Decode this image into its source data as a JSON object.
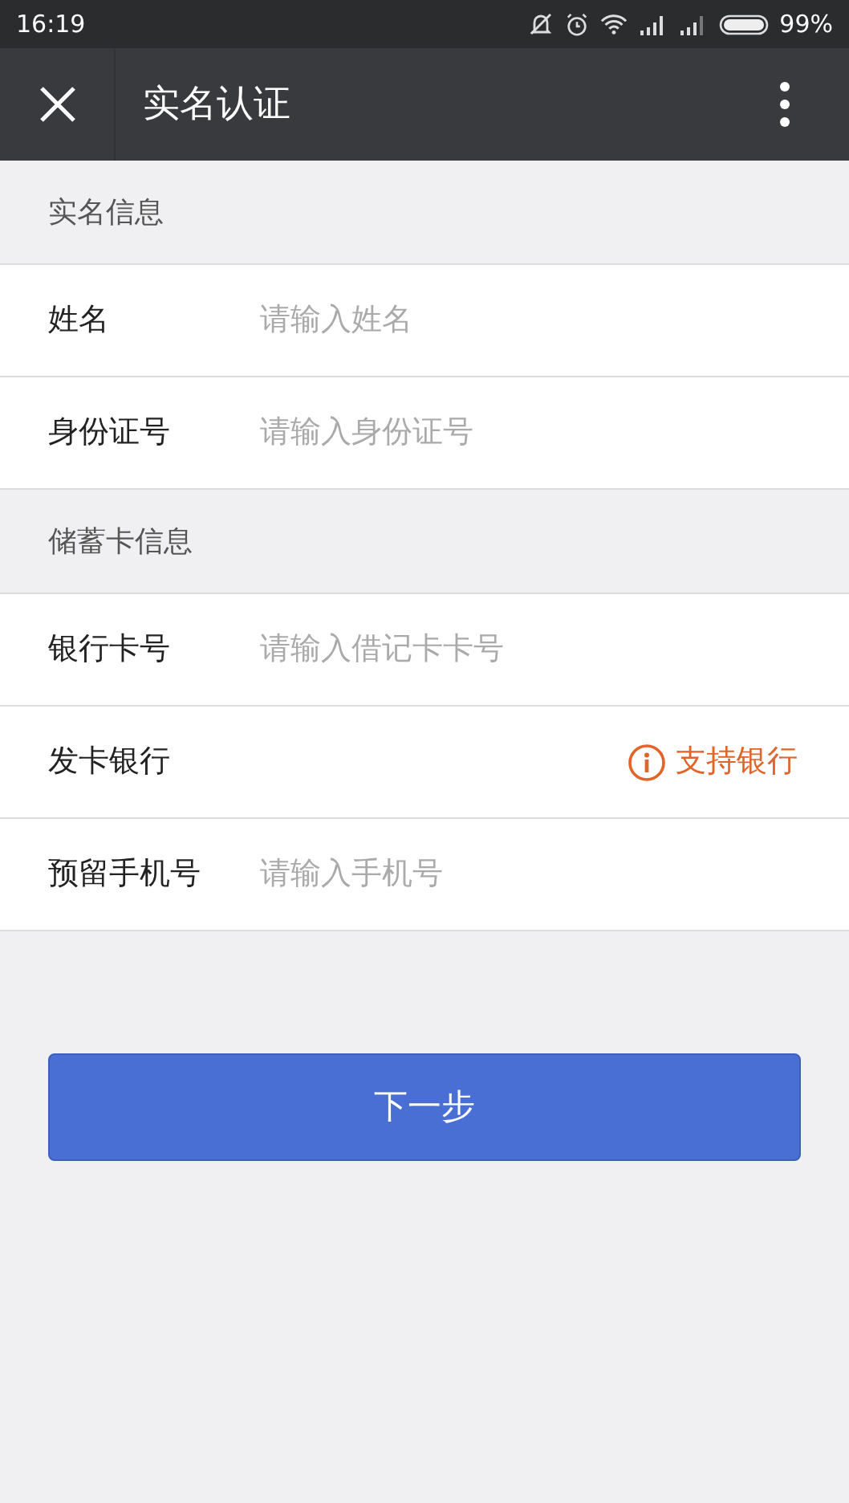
{
  "status_bar": {
    "time": "16:19",
    "battery": "99%"
  },
  "nav_bar": {
    "title": "实名认证"
  },
  "sections": [
    {
      "title": "实名信息",
      "rows": [
        {
          "kind": "input",
          "label": "姓名",
          "placeholder": "请输入姓名"
        },
        {
          "kind": "input",
          "label": "身份证号",
          "placeholder": "请输入身份证号"
        }
      ]
    },
    {
      "title": "储蓄卡信息",
      "rows": [
        {
          "kind": "input",
          "label": "银行卡号",
          "placeholder": "请输入借记卡卡号"
        },
        {
          "kind": "link",
          "label": "发卡银行",
          "link": "支持银行"
        },
        {
          "kind": "input",
          "label": "预留手机号",
          "placeholder": "请输入手机号"
        }
      ]
    }
  ],
  "next_button": {
    "label": "下一步"
  }
}
